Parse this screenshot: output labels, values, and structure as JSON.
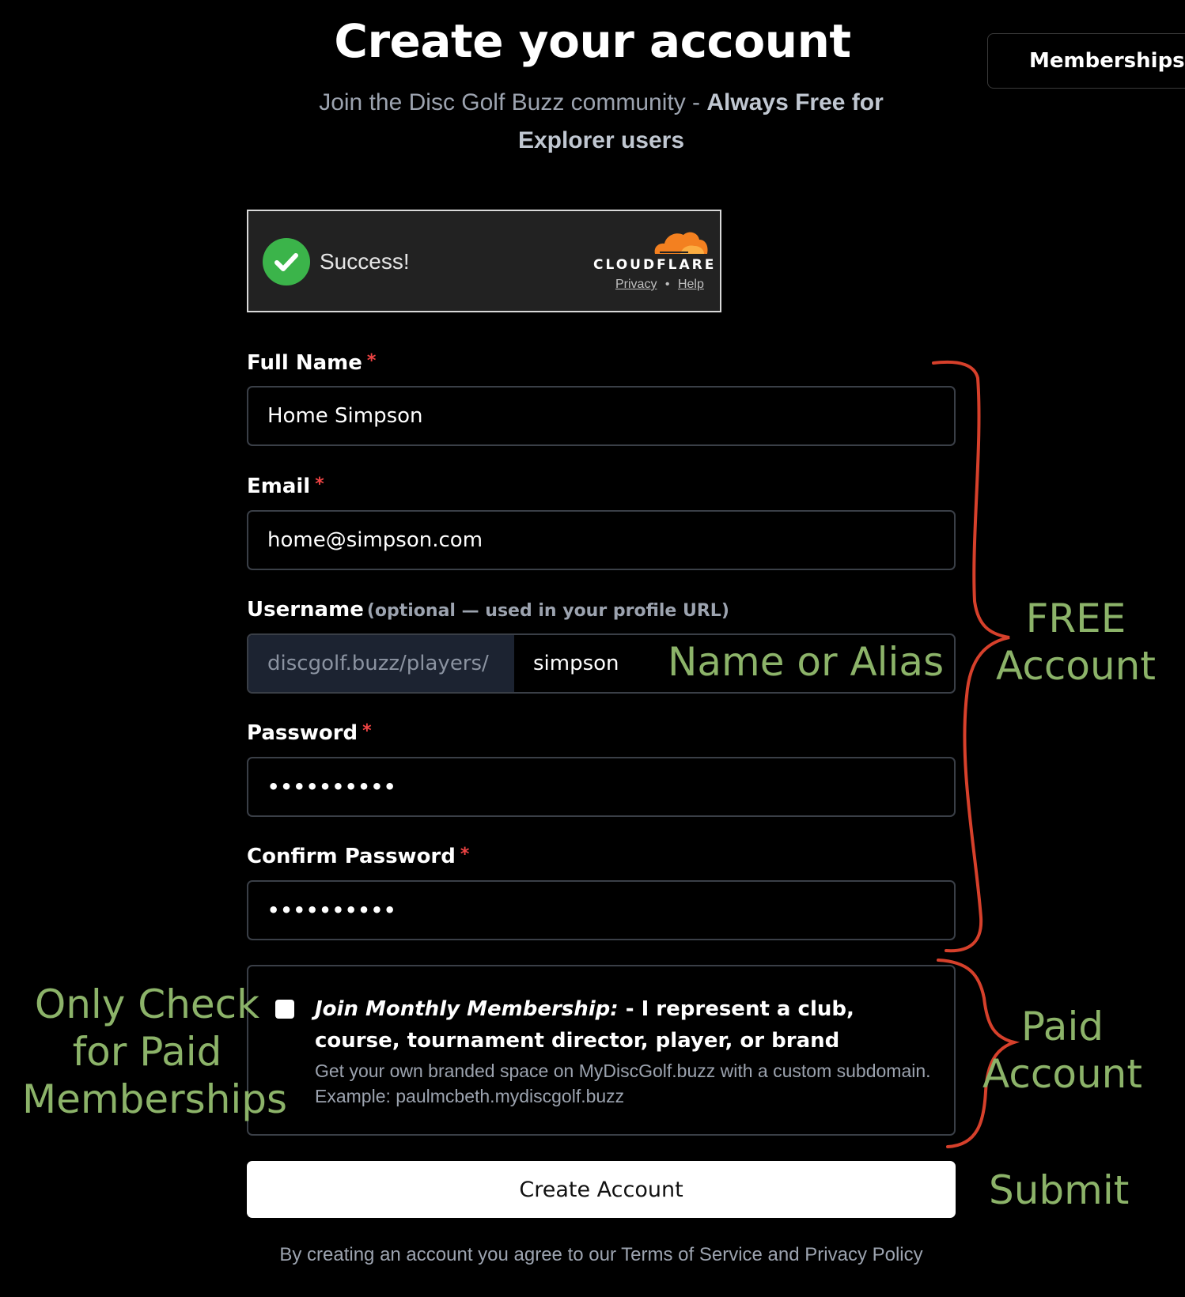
{
  "header": {
    "title": "Create your account",
    "subtitle_plain": "Join the Disc Golf Buzz community - ",
    "subtitle_bold": "Always Free for Explorer users",
    "memberships_label": "Memberships"
  },
  "captcha": {
    "status": "Success!",
    "brand": "CLOUDFLARE",
    "privacy_link": "Privacy",
    "separator": "•",
    "help_link": "Help"
  },
  "form": {
    "full_name": {
      "label": "Full Name",
      "required_mark": "*",
      "value": "Home Simpson"
    },
    "email": {
      "label": "Email",
      "required_mark": "*",
      "value": "home@simpson.com"
    },
    "username": {
      "label": "Username",
      "hint": "(optional — used in your profile URL)",
      "prefix": "discgolf.buzz/players/",
      "value": "simpson"
    },
    "password": {
      "label": "Password",
      "required_mark": "*",
      "value": "••••••••••"
    },
    "confirm_password": {
      "label": "Confirm Password",
      "required_mark": "*",
      "value": "••••••••••"
    },
    "membership": {
      "checked": false,
      "title_italic": "Join Monthly Membership:",
      "title_rest": " - I represent a club, course, tournament director, player, or brand",
      "description": "Get your own branded space on MyDiscGolf.buzz with a custom subdomain. Example: paulmcbeth.mydiscgolf.buzz"
    },
    "submit_label": "Create Account",
    "terms": "By creating an account you agree to our Terms of Service and Privacy Policy"
  },
  "annotations": {
    "name_alias": "Name or Alias",
    "free_line1": "FREE",
    "free_line2": "Account",
    "only_check_line1": "Only Check",
    "only_check_line2": "for Paid",
    "only_check_line3": "Memberships",
    "paid_line1": "Paid",
    "paid_line2": "Account",
    "submit": "Submit",
    "annotation_text_color": "#8cb369",
    "bracket_color": "#d6402b"
  },
  "colors": {
    "background": "#000000",
    "required": "#ef4444",
    "success_green": "#3bb44a",
    "cloudflare_orange": "#f38020"
  }
}
